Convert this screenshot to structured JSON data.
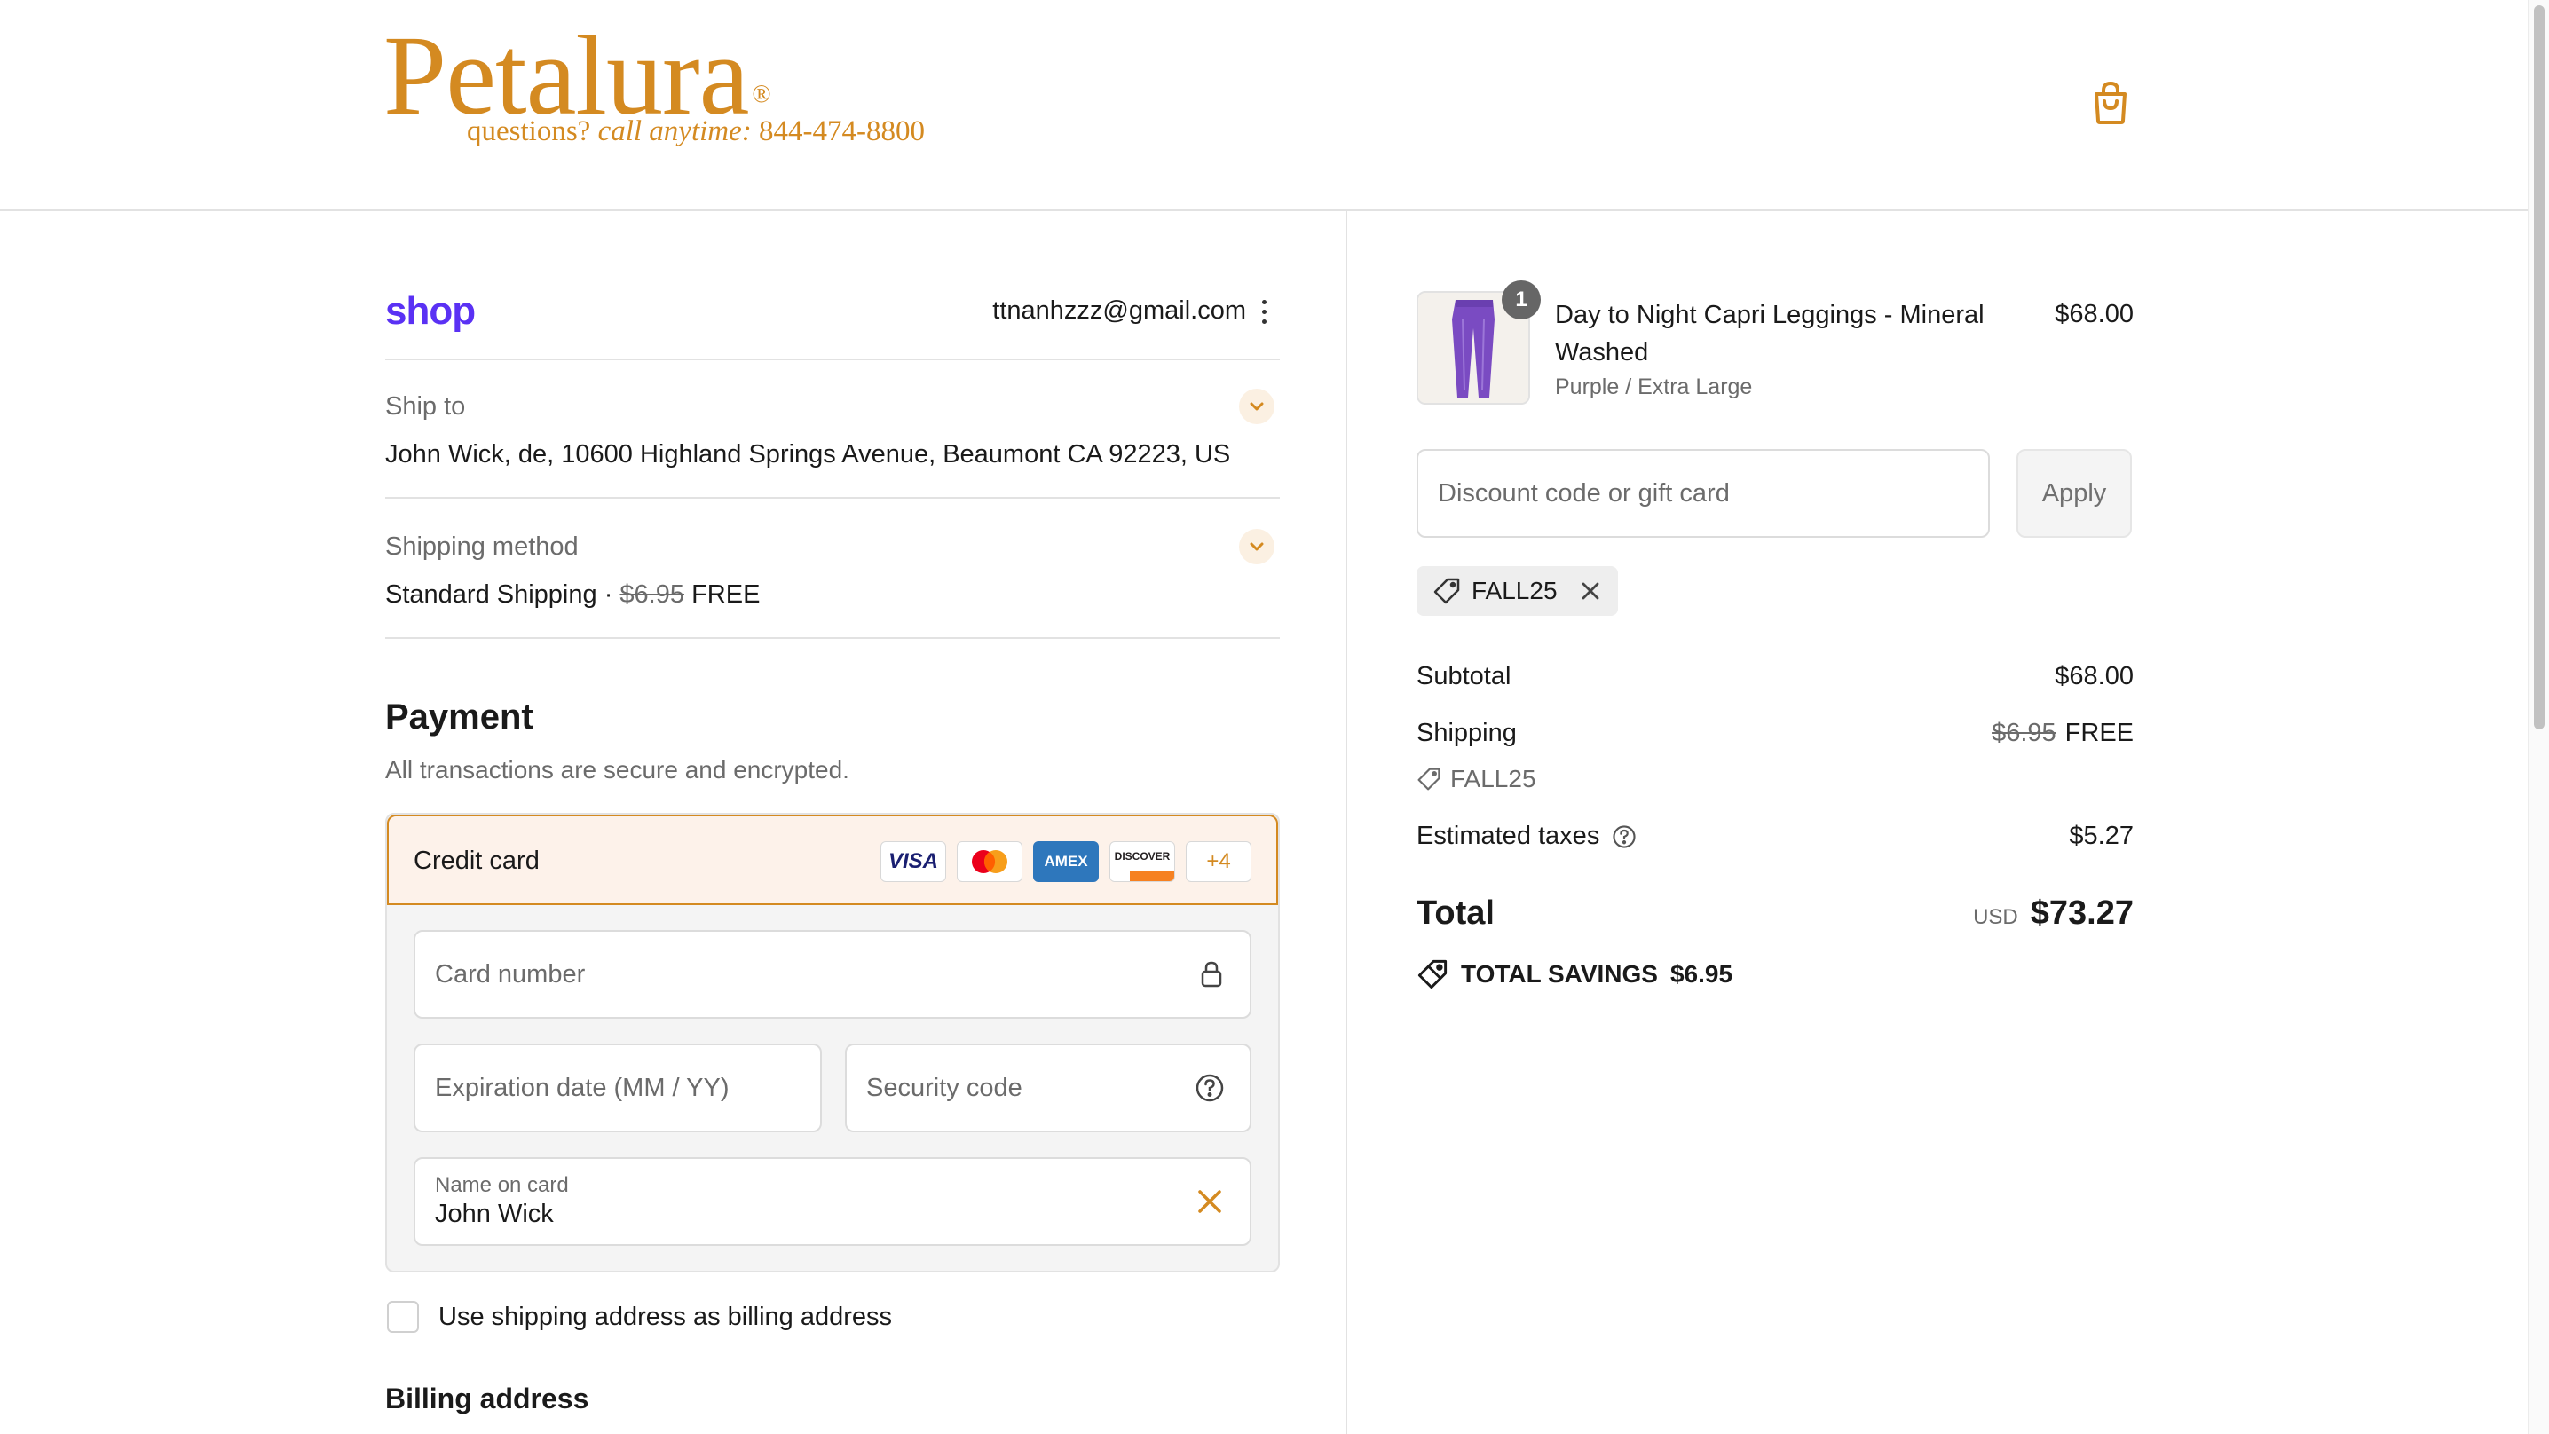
{
  "header": {
    "brand_word": "Petalura",
    "brand_reg": "®",
    "tagline_prefix": "questions? ",
    "tagline_italic": "call anytime:",
    "tagline_phone": " 844-474-8800",
    "cart_icon": "shopping-bag-icon"
  },
  "account": {
    "shop_label": "shop",
    "email": "ttnanhzzz@gmail.com",
    "menu_icon": "kebab-icon"
  },
  "ship_to": {
    "label": "Ship to",
    "value": "John Wick, de, 10600 Highland Springs Avenue, Beaumont CA 92223, US"
  },
  "shipping_method": {
    "label": "Shipping method",
    "name": "Standard Shipping",
    "separator": " · ",
    "original_price": "$6.95",
    "price": "FREE"
  },
  "payment": {
    "title": "Payment",
    "subtitle": "All transactions are secure and encrypted.",
    "method_label": "Credit card",
    "card_brands": [
      "VISA",
      "",
      "AMEX",
      "DISCOVER",
      "+4"
    ],
    "card_number_placeholder": "Card number",
    "expiry_placeholder": "Expiration date (MM / YY)",
    "security_placeholder": "Security code",
    "name_label": "Name on card",
    "name_value": "John Wick",
    "billing_checkbox_label": "Use shipping address as billing address",
    "billing_title": "Billing address",
    "accent_color": "#d48a21"
  },
  "order": {
    "quantity": "1",
    "product_name": "Day to Night Capri Leggings - Mineral Washed",
    "variant": "Purple / Extra Large",
    "price": "$68.00",
    "discount_placeholder": "Discount code or gift card",
    "apply_label": "Apply",
    "applied_code": "FALL25",
    "subtotal_label": "Subtotal",
    "subtotal_value": "$68.00",
    "shipping_label": "Shipping",
    "shipping_original": "$6.95",
    "shipping_value": "FREE",
    "shipping_code": "FALL25",
    "taxes_label": "Estimated taxes",
    "taxes_value": "$5.27",
    "total_label": "Total",
    "total_currency": "USD",
    "total_value": "$73.27",
    "savings_label": "TOTAL SAVINGS",
    "savings_value": "$6.95"
  }
}
